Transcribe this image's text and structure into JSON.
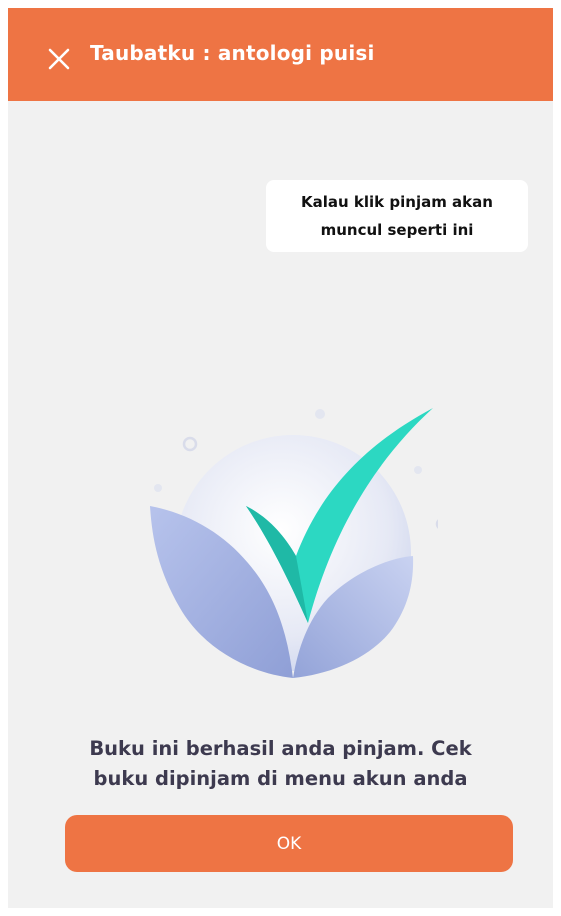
{
  "header": {
    "title": "Taubatku : antologi puisi",
    "close_icon": "close-icon",
    "background_color": "#ee7444"
  },
  "annotation": {
    "line1": "Kalau klik pinjam akan",
    "line2": "muncul seperti ini"
  },
  "illustration": {
    "icon": "success-checkmark-icon",
    "check_color": "#2cd8c2",
    "leaf_color": "#a7b6e4"
  },
  "dialog": {
    "message_line1": "Buku ini berhasil anda pinjam. Cek",
    "message_line2": "buku dipinjam di menu akun anda",
    "ok_label": "OK",
    "button_color": "#ee7444"
  }
}
